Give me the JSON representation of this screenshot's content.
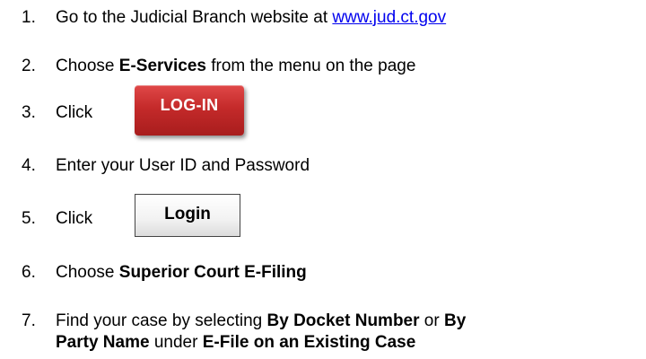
{
  "steps": [
    {
      "num": "1.",
      "pre": "Go to the Judicial Branch website at ",
      "link": "www.jud.ct.gov"
    },
    {
      "num": "2.",
      "pre": "Choose ",
      "bold": "E-Services",
      "post": " from the menu on the page"
    },
    {
      "num": "3.",
      "text": "Click"
    },
    {
      "num": "4.",
      "text": "Enter your User ID and Password"
    },
    {
      "num": "5.",
      "text": "Click"
    },
    {
      "num": "6.",
      "pre": "Choose ",
      "bold": "Superior Court E-Filing"
    },
    {
      "num": "7.",
      "line1_pre": "Find your case by selecting ",
      "line1_bold1": "By Docket Number",
      "line1_mid": " or ",
      "line1_bold2": "By",
      "line2_bold1": "Party Name",
      "line2_mid": " under ",
      "line2_bold2": "E-File on an Existing Case"
    }
  ],
  "buttons": {
    "log_in_label": "LOG-IN",
    "login_label": "Login"
  },
  "colors": {
    "link": "#0000ee",
    "log_in_button": "#c42a2a"
  }
}
